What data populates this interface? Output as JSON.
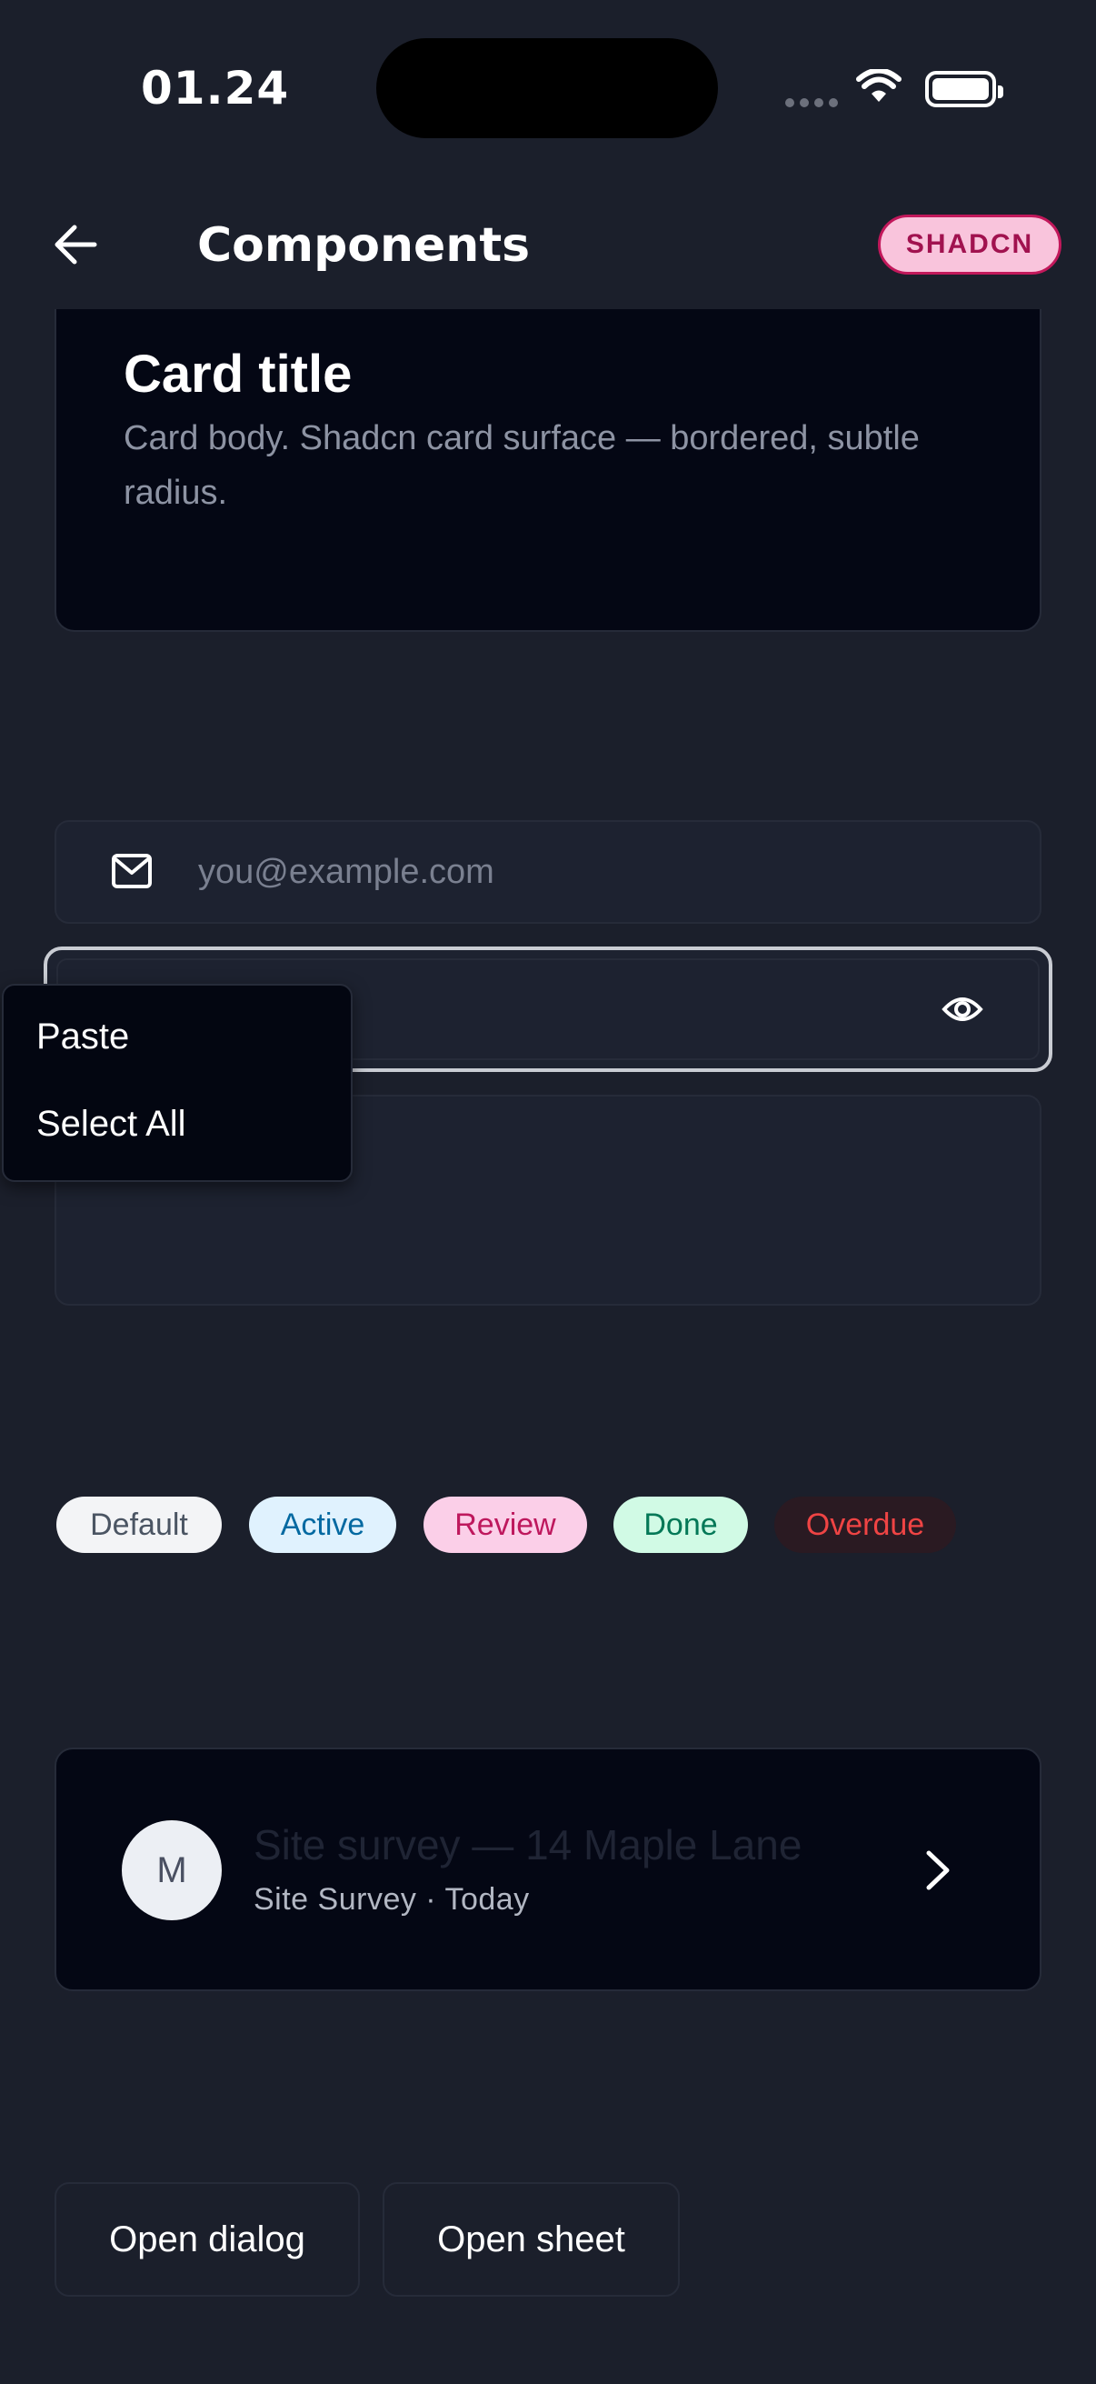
{
  "status_bar": {
    "time": "01.24"
  },
  "header": {
    "title": "Components",
    "badge": "SHADCN"
  },
  "card": {
    "title": "Card title",
    "body": "Card body. Shadcn card surface — bordered, subtle radius."
  },
  "email_field": {
    "placeholder": "you@example.com"
  },
  "context_menu": {
    "items": [
      "Paste",
      "Select All"
    ]
  },
  "chips": [
    {
      "label": "Default",
      "bg": "#f3f4f6",
      "fg": "#4b5563"
    },
    {
      "label": "Active",
      "bg": "#e0f2fe",
      "fg": "#0369a1"
    },
    {
      "label": "Review",
      "bg": "#fbcfe8",
      "fg": "#be185d"
    },
    {
      "label": "Done",
      "bg": "#d1fae5",
      "fg": "#047857"
    },
    {
      "label": "Overdue",
      "bg": "#2a1a22",
      "fg": "#ef4444"
    }
  ],
  "list_item": {
    "avatar": "M",
    "title": "Site survey — 14 Maple Lane",
    "subtitle": "Site Survey · Today"
  },
  "buttons": {
    "dialog": "Open dialog",
    "sheet": "Open sheet"
  },
  "colors": {
    "background": "#1b1f2b",
    "surface": "#040714",
    "accent": "#c2185b"
  }
}
